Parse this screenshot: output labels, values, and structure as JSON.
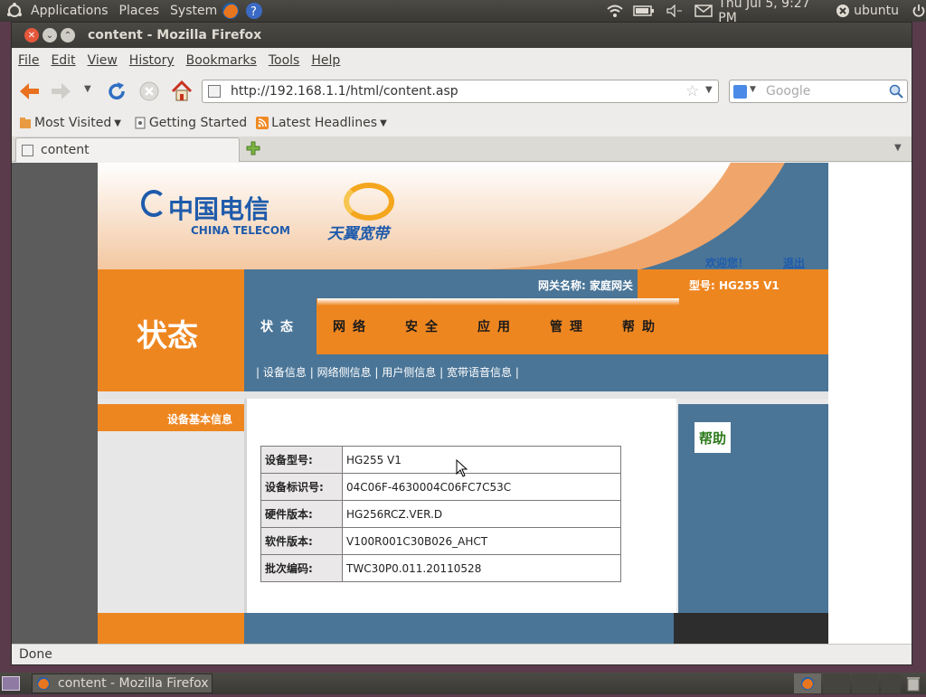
{
  "desktop": {
    "menus": [
      "Applications",
      "Places",
      "System"
    ],
    "clock": "Thu Jul  5,  9:27 PM",
    "user": "ubuntu"
  },
  "window": {
    "title": "content - Mozilla Firefox"
  },
  "menubar": [
    "File",
    "Edit",
    "View",
    "History",
    "Bookmarks",
    "Tools",
    "Help"
  ],
  "nav": {
    "url": "http://192.168.1.1/html/content.asp",
    "search_placeholder": "Google"
  },
  "bookmarks": [
    "Most Visited",
    "Getting Started",
    "Latest Headlines"
  ],
  "tab": {
    "label": "content"
  },
  "status": "Done",
  "taskbar": {
    "item": "content - Mozilla Firefox"
  },
  "router": {
    "logo_cn": "中国电信",
    "logo_en": "CHINA TELECOM",
    "brand2": "天翼宽带",
    "welcome": "欢迎您！",
    "logout": "退出",
    "gateway_name_label": "网关名称: 家庭网关",
    "model_label": "型号: HG255 V1",
    "section_title": "状态",
    "tabs": [
      "状态",
      "网络",
      "安全",
      "应用",
      "管理",
      "帮助"
    ],
    "subnav": [
      "设备信息",
      "网络侧信息",
      "用户侧信息",
      "宽带语音信息"
    ],
    "sidebar_item": "设备基本信息",
    "help": "帮助",
    "rows": [
      {
        "k": "设备型号:",
        "v": "HG255 V1"
      },
      {
        "k": "设备标识号:",
        "v": "04C06F-4630004C06FC7C53C"
      },
      {
        "k": "硬件版本:",
        "v": "HG256RCZ.VER.D"
      },
      {
        "k": "软件版本:",
        "v": "V100R001C30B026_AHCT"
      },
      {
        "k": "批次编码:",
        "v": "TWC30P0.011.20110528"
      }
    ]
  },
  "colors": {
    "orange": "#ee8620",
    "steel": "#4a7597",
    "dark": "#2d2d2d"
  }
}
